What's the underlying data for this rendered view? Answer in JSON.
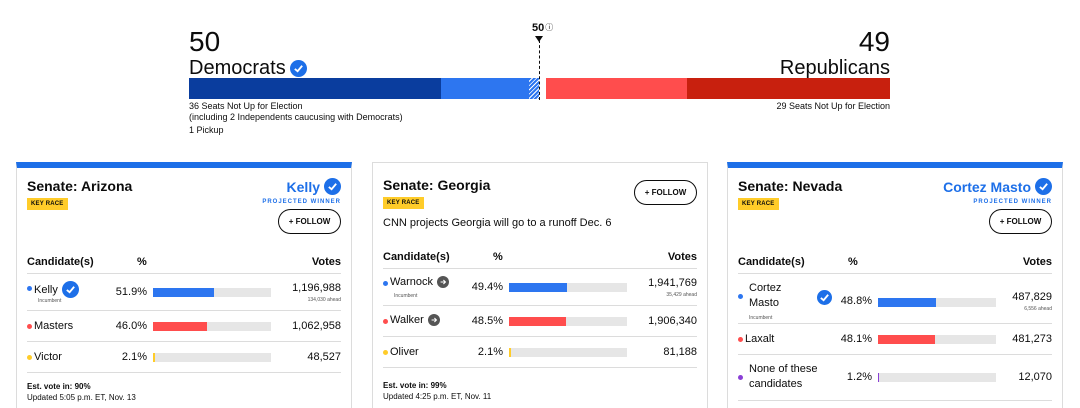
{
  "balance": {
    "dem": {
      "count": "50",
      "label": "Democrats",
      "note_line1": "36 Seats Not Up for Election",
      "note_line2": "(including 2 Independents caucusing with Democrats)",
      "pickup": "1 Pickup"
    },
    "rep": {
      "count": "49",
      "label": "Republicans",
      "note": "29 Seats Not Up for Election"
    },
    "majority": "50",
    "majority_icon": "ⓘ",
    "colors": {
      "dem_dark": "#0a3d9e",
      "dem_light": "#2d76f0",
      "rep_light": "#ff4d4d",
      "rep_dark": "#c8200e"
    }
  },
  "common": {
    "key_race": "KEY RACE",
    "follow": "+ FOLLOW",
    "projected_winner": "PROJECTED WINNER",
    "col_candidate": "Candidate(s)",
    "col_pct": "%",
    "col_votes": "Votes"
  },
  "races": [
    {
      "title": "Senate: Arizona",
      "winner": "Kelly",
      "candidates": [
        {
          "name": "Kelly",
          "sub": "Incumbent",
          "pct": "51.9%",
          "pct_value": 51.9,
          "votes": "1,196,988",
          "ahead": "134,030 ahead",
          "color": "#2d76f0"
        },
        {
          "name": "Masters",
          "pct": "46.0%",
          "pct_value": 46.0,
          "votes": "1,062,958",
          "color": "#ff4d4d"
        },
        {
          "name": "Victor",
          "pct": "2.1%",
          "pct_value": 2.1,
          "votes": "48,527",
          "color": "#ffcc29"
        }
      ],
      "est_vote": "Est. vote in: 90%",
      "updated": "Updated 5:05 p.m. ET, Nov. 13"
    },
    {
      "title": "Senate: Georgia",
      "runoff": "CNN projects Georgia will go to a runoff Dec. 6",
      "candidates": [
        {
          "name": "Warnock",
          "sub": "Incumbent",
          "pct": "49.4%",
          "pct_value": 49.4,
          "votes": "1,941,769",
          "ahead": "35,429 ahead",
          "color": "#2d76f0"
        },
        {
          "name": "Walker",
          "pct": "48.5%",
          "pct_value": 48.5,
          "votes": "1,906,340",
          "color": "#ff4d4d"
        },
        {
          "name": "Oliver",
          "pct": "2.1%",
          "pct_value": 2.1,
          "votes": "81,188",
          "color": "#ffcc29"
        }
      ],
      "est_vote": "Est. vote in: 99%",
      "updated": "Updated 4:25 p.m. ET, Nov. 11"
    },
    {
      "title": "Senate: Nevada",
      "winner": "Cortez Masto",
      "candidates": [
        {
          "name_line1": "Cortez",
          "name_line2": "Masto",
          "sub": "Incumbent",
          "pct": "48.8%",
          "pct_value": 48.8,
          "votes": "487,829",
          "ahead": "6,556 ahead",
          "color": "#2d76f0"
        },
        {
          "name": "Laxalt",
          "pct": "48.1%",
          "pct_value": 48.1,
          "votes": "481,273",
          "color": "#ff4d4d"
        },
        {
          "name_line1": "None of these",
          "name_line2": "candidates",
          "pct": "1.2%",
          "pct_value": 1.2,
          "votes": "12,070",
          "color": "#8a3fd6"
        }
      ]
    }
  ]
}
